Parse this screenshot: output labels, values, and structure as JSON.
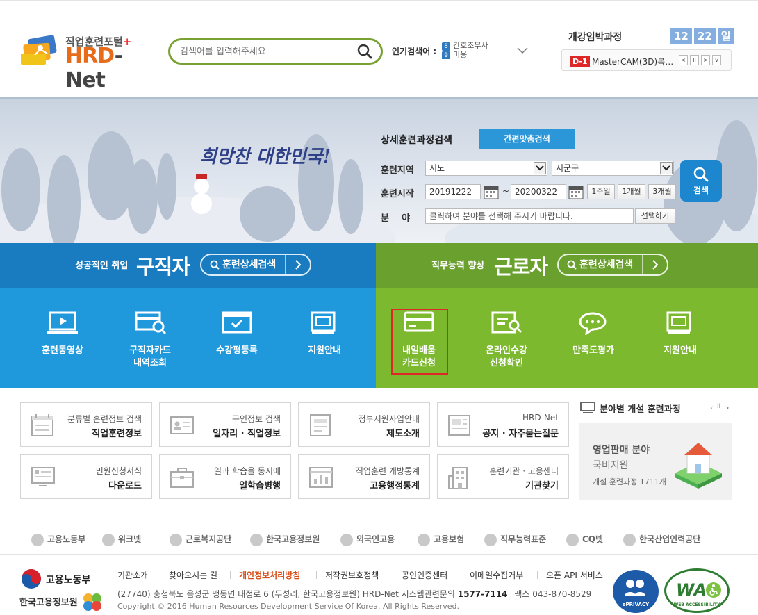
{
  "header": {
    "logo_sub": "직업훈련포털",
    "logo_plus": "+",
    "logo_hrd": "HRD",
    "logo_net": "-Net",
    "search_placeholder": "검색어를 입력해주세요",
    "popular_label": "인기검색어 :",
    "popular_items": [
      {
        "num": "8",
        "text": "간호조무사"
      },
      {
        "num": "9",
        "text": "미용"
      }
    ],
    "upcoming_title": "개강임박과정",
    "date": {
      "month": "12",
      "day": "22",
      "weekday": "일"
    },
    "dday": "D-1",
    "upcoming_course": "MasterCAM(3D)복…"
  },
  "hero": {
    "slogan": "희망찬 대한민국!",
    "detail_search_title": "상세훈련과정검색",
    "quick_search_btn": "간편맞춤검색",
    "region_label": "훈련지역",
    "region_sido": "시도",
    "region_sigungu": "시군구",
    "start_label": "훈련시작",
    "date_from": "20191222",
    "tilde": "~",
    "date_to": "20200322",
    "range_buttons": [
      "1주일",
      "1개월",
      "3개월"
    ],
    "field_label": "분    야",
    "field_placeholder": "클릭하여 분야를 선택해 주시기 바랍니다.",
    "field_select_btn": "선택하기",
    "search_btn": "검색"
  },
  "jobseeker": {
    "sub": "성공적인 취업",
    "title": "구직자",
    "pill": "훈련상세검색",
    "menu": [
      {
        "label": "훈련동영상",
        "label2": ""
      },
      {
        "label": "구직자카드",
        "label2": "내역조회"
      },
      {
        "label": "수강평등록",
        "label2": ""
      },
      {
        "label": "지원안내",
        "label2": ""
      }
    ]
  },
  "worker": {
    "sub": "직무능력 향상",
    "title": "근로자",
    "pill": "훈련상세검색",
    "menu": [
      {
        "label": "내일배움",
        "label2": "카드신청"
      },
      {
        "label": "온라인수강",
        "label2": "신청확인"
      },
      {
        "label": "만족도평가",
        "label2": ""
      },
      {
        "label": "지원안내",
        "label2": ""
      }
    ]
  },
  "tiles": [
    {
      "t1": "분류별 훈련정보 검색",
      "t2": "직업훈련정보"
    },
    {
      "t1": "구인정보 검색",
      "t2": "일자리 · 직업정보"
    },
    {
      "t1": "정부지원사업안내",
      "t2": "제도소개"
    },
    {
      "t1": "HRD-Net",
      "t2": "공지 · 자주묻는질문"
    },
    {
      "t1": "민원신청서식",
      "t2": "다운로드"
    },
    {
      "t1": "일과 학습을 동시에",
      "t2": "일학습병행"
    },
    {
      "t1": "직업훈련 개방통계",
      "t2": "고용행정통계"
    },
    {
      "t1": "훈련기관 · 고용센터",
      "t2": "기관찾기"
    }
  ],
  "field_course": {
    "title": "분야별 개설 훈련과정",
    "category": "영업판매 분야",
    "support": "국비지원",
    "count_text": "개설 훈련과정 1711개"
  },
  "family_links": [
    "고용노동부",
    "워크넷",
    "근로복지공단",
    "한국고용정보원",
    "외국인고용",
    "고용보험",
    "직무능력표준",
    "CQ넷",
    "한국산업인력공단"
  ],
  "footer": {
    "ministry": "고용노동부",
    "agency": "한국고용정보원",
    "links": [
      "기관소개",
      "찾아오시는 길",
      "개인정보처리방침",
      "저작권보호정책",
      "공인인증센터",
      "이메일수집거부",
      "오픈 API 서비스"
    ],
    "address": "(27740) 충청북도 음성군 맹동면 태정로 6 (두성리, 한국고용정보원) HRD-Net 시스템관련문의",
    "phone": "1577-7114",
    "fax": "팩스 043-870-8529",
    "copyright": "Copyright © 2016 Human Resources Development Service Of Korea. All Rights Reserved.",
    "badge_privacy": "ePRIVACY",
    "badge_wa": "WA",
    "badge_wa_text": "WEB ACCESSIBILITY"
  },
  "colors": {
    "accent_green": "#7aa232",
    "jobseeker_blue": "#1f99dc",
    "worker_green": "#7cb92f",
    "highlight_red": "#e02727"
  }
}
